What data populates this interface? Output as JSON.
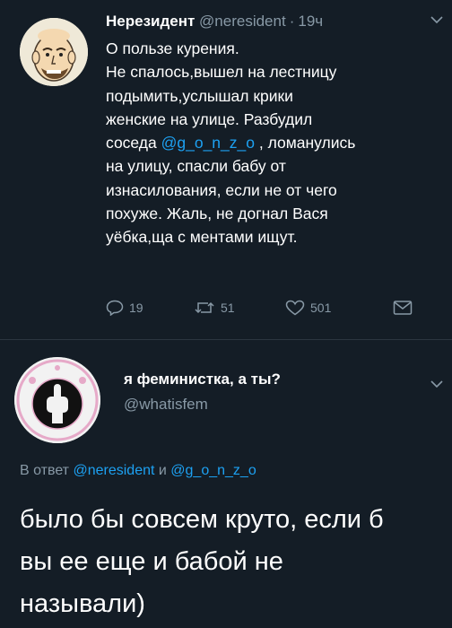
{
  "tweet1": {
    "name": "Нерезидент",
    "handle": "@neresident",
    "time": "19ч",
    "lines": [
      "О пользе курения.",
      "Не спалось,вышел на лестницу",
      "подымить,услышал крики",
      "женские на улице. Разбудил",
      ", ломанулись",
      "на улицу, спасли бабу от",
      "изнасилования, если не от чего",
      "похуже. Жаль, не догнал Вася",
      "уёбка,ща с ментами ищут."
    ],
    "line5_prefix": "соседа",
    "mention": "@g_o_n_z_o",
    "replies": "19",
    "retweets": "51",
    "likes": "501"
  },
  "tweet2": {
    "name": "я феминистка, а ты?",
    "handle": "@whatisfem",
    "reply_prefix": "В ответ",
    "reply_mention1": "@neresident",
    "reply_and": "и",
    "reply_mention2": "@g_o_n_z_o",
    "lines": [
      "было бы совсем круто, если б",
      "вы ее еще и бабой не",
      "называли)"
    ]
  },
  "icons": {
    "reply": "reply-icon",
    "retweet": "retweet-icon",
    "like": "heart-icon",
    "dm": "envelope-icon",
    "more": "chevron-down-icon"
  },
  "colors": {
    "background": "#141d26",
    "muted": "#8899a6",
    "link": "#1da1f2"
  }
}
